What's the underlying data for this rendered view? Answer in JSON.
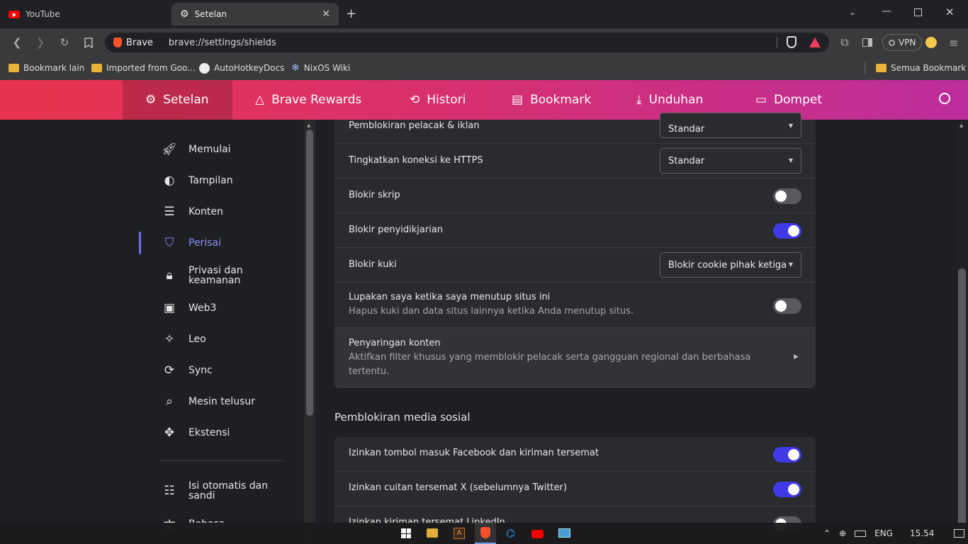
{
  "tabs": [
    {
      "title": "YouTube",
      "icon": "youtube-icon"
    },
    {
      "title": "Setelan",
      "icon": "gear-icon"
    }
  ],
  "toolbar": {
    "brand": "Brave",
    "url": "brave://settings/shields",
    "vpn_label": "VPN"
  },
  "bookmarks": {
    "items": [
      "Bookmark lain",
      "Imported from Goo...",
      "AutoHotkeyDocs",
      "NixOS Wiki"
    ],
    "all_bookmarks": "Semua Bookmark"
  },
  "header": {
    "nav": [
      "Setelan",
      "Brave Rewards",
      "Histori",
      "Bookmark",
      "Unduhan",
      "Dompet"
    ]
  },
  "sidebar": {
    "items": [
      {
        "label": "Memulai",
        "icon": "rocket-icon"
      },
      {
        "label": "Tampilan",
        "icon": "palette-icon"
      },
      {
        "label": "Konten",
        "icon": "content-icon"
      },
      {
        "label": "Perisai",
        "icon": "shield-icon"
      },
      {
        "label": "Privasi dan keamanan",
        "icon": "lock-icon"
      },
      {
        "label": "Web3",
        "icon": "wallet-icon"
      },
      {
        "label": "Leo",
        "icon": "leo-icon"
      },
      {
        "label": "Sync",
        "icon": "sync-icon"
      },
      {
        "label": "Mesin telusur",
        "icon": "search-icon"
      },
      {
        "label": "Ekstensi",
        "icon": "puzzle-icon"
      },
      {
        "label": "Isi otomatis dan sandi",
        "icon": "autofill-icon"
      },
      {
        "label": "Bahasa",
        "icon": "translate-icon"
      }
    ],
    "active": "Perisai"
  },
  "settings": {
    "tracker_label": "Pemblokiran pelacak & iklan",
    "tracker_value": "Standar",
    "https_label": "Tingkatkan koneksi ke HTTPS",
    "https_value": "Standar",
    "script_label": "Blokir skrip",
    "script_on": false,
    "fingerprint_label": "Blokir penyidikjarian",
    "fingerprint_on": true,
    "cookie_label": "Blokir kuki",
    "cookie_value": "Blokir cookie pihak ketiga",
    "forget_title": "Lupakan saya ketika saya menutup situs ini",
    "forget_sub": "Hapus kuki dan data situs lainnya ketika Anda menutup situs.",
    "forget_on": false,
    "filter_title": "Penyaringan konten",
    "filter_sub": "Aktifkan filter khusus yang memblokir pelacak serta gangguan regional dan berbahasa tertentu."
  },
  "social": {
    "section_title": "Pemblokiran media sosial",
    "facebook_label": "Izinkan tombol masuk Facebook dan kiriman tersemat",
    "facebook_on": true,
    "twitter_label": "Izinkan cuitan tersemat X (sebelumnya Twitter)",
    "twitter_on": true,
    "linkedin_label": "Izinkan kiriman tersemat LinkedIn",
    "linkedin_on": false
  },
  "taskbar": {
    "lang": "ENG",
    "time": "15.54"
  },
  "colors": {
    "accent": "#3f39e8",
    "header_start": "#e9344d",
    "header_end": "#bc2d9c",
    "active_nav": "#8b8ef8"
  }
}
